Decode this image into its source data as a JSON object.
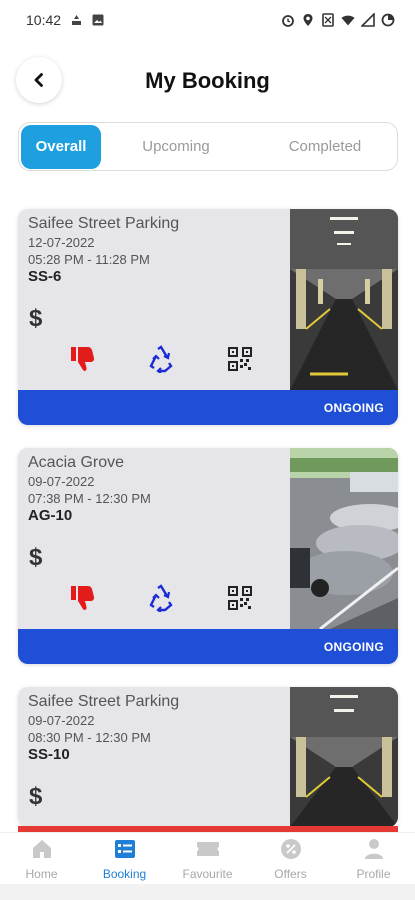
{
  "status_bar": {
    "time": "10:42"
  },
  "header": {
    "title": "My Booking"
  },
  "tabs": [
    {
      "label": "Overall",
      "active": true
    },
    {
      "label": "Upcoming",
      "active": false
    },
    {
      "label": "Completed",
      "active": false
    }
  ],
  "bookings": [
    {
      "name": "Saifee Street Parking",
      "date": "12-07-2022",
      "time": "05:28 PM - 11:28 PM",
      "slot": "SS-6",
      "currency": "$",
      "status": "ONGOING"
    },
    {
      "name": "Acacia Grove",
      "date": "09-07-2022",
      "time": "07:38 PM - 12:30 PM",
      "slot": "AG-10",
      "currency": "$",
      "status": "ONGOING"
    },
    {
      "name": "Saifee Street Parking",
      "date": "09-07-2022",
      "time": "08:30 PM - 12:30 PM",
      "slot": "SS-10",
      "currency": "$",
      "status": ""
    }
  ],
  "nav": [
    {
      "label": "Home",
      "icon": "home-icon"
    },
    {
      "label": "Booking",
      "icon": "booking-icon"
    },
    {
      "label": "Favourite",
      "icon": "ticket-icon"
    },
    {
      "label": "Offers",
      "icon": "discount-icon"
    },
    {
      "label": "Profile",
      "icon": "profile-icon"
    }
  ],
  "colors": {
    "accent": "#1e9fe0",
    "status_ongoing": "#1f4fd6",
    "dislike": "#e21b1b",
    "recycle": "#1b2bd6",
    "card_bg": "#e6e6ea",
    "nav_active": "#1f7fd6"
  }
}
